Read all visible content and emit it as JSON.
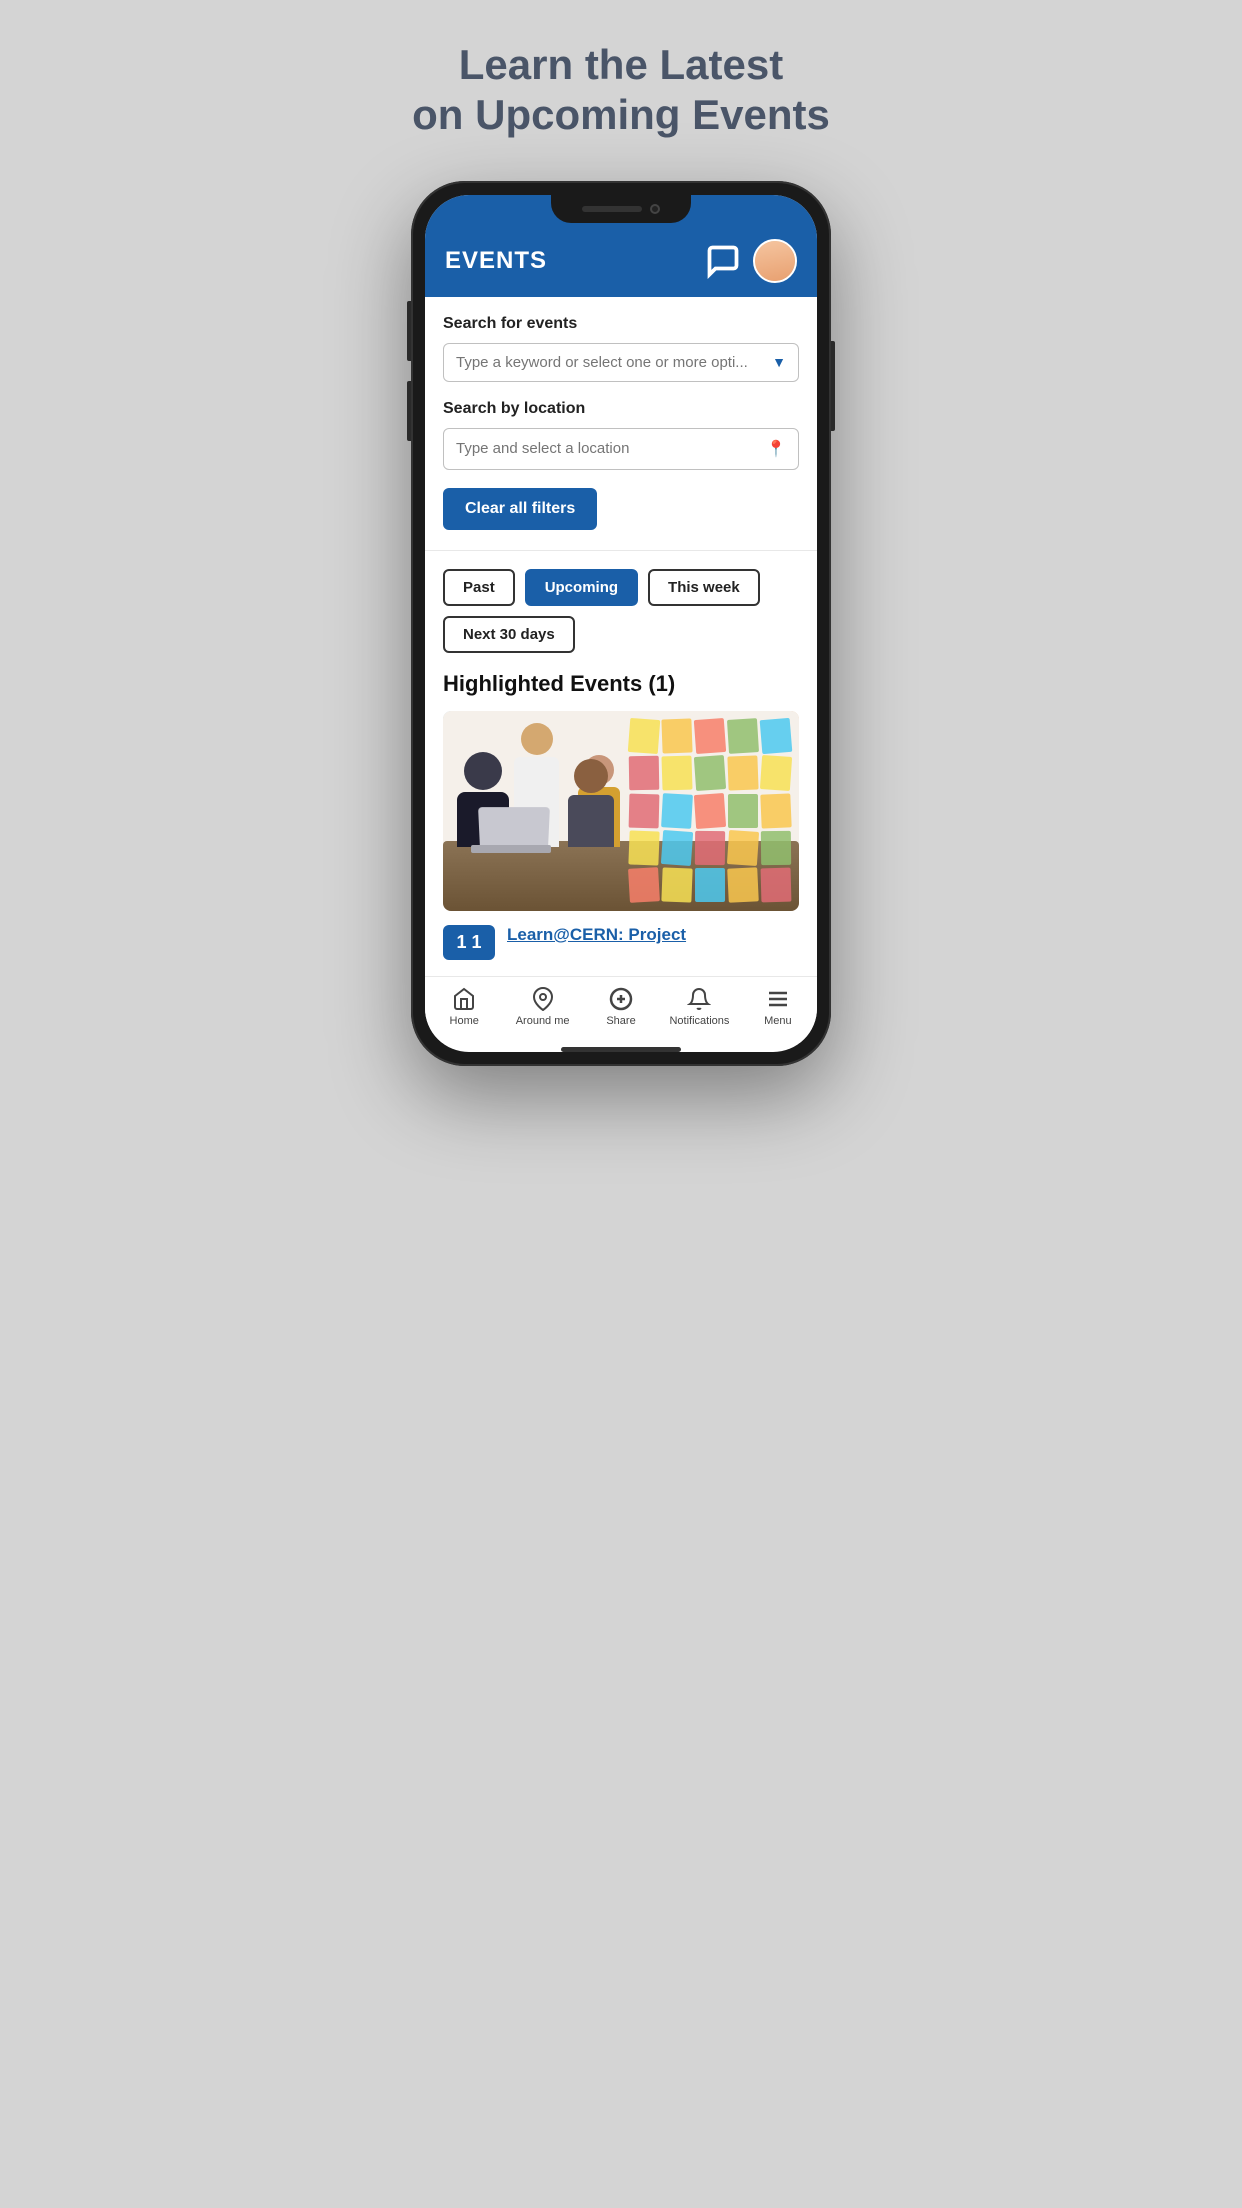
{
  "page": {
    "headline_line1": "Learn the Latest",
    "headline_line2": "on Upcoming Events"
  },
  "app": {
    "header": {
      "title": "EVENTS",
      "chat_icon_label": "chat",
      "avatar_label": "user avatar"
    },
    "search": {
      "keyword_label": "Search for events",
      "keyword_placeholder": "Type a keyword or select one or more opti...",
      "location_label": "Search by location",
      "location_placeholder": "Type and select a location"
    },
    "filters": {
      "clear_label": "Clear all filters",
      "tabs": [
        {
          "id": "past",
          "label": "Past",
          "active": false
        },
        {
          "id": "upcoming",
          "label": "Upcoming",
          "active": true
        },
        {
          "id": "this_week",
          "label": "This week",
          "active": false
        },
        {
          "id": "next_30",
          "label": "Next 30 days",
          "active": false
        }
      ]
    },
    "highlighted_title": "Highlighted Events (1)",
    "event": {
      "date_month": "",
      "date_day": "1 1",
      "title": "Learn@CERN: Project"
    },
    "bottom_nav": [
      {
        "id": "home",
        "label": "Home",
        "icon": "🏠"
      },
      {
        "id": "around_me",
        "label": "Around me",
        "icon": "📍"
      },
      {
        "id": "share",
        "label": "Share",
        "icon": "➕"
      },
      {
        "id": "notifications",
        "label": "Notifications",
        "icon": "🔔"
      },
      {
        "id": "menu",
        "label": "Menu",
        "icon": "☰"
      }
    ]
  },
  "colors": {
    "primary_blue": "#1a5fa8",
    "dark_text": "#222222",
    "light_gray": "#d4d4d4",
    "border_gray": "#c0c0c0"
  },
  "sticky_colors": [
    "#f7e155",
    "#f9c74f",
    "#f77f6a",
    "#90be6d",
    "#4cc9f0",
    "#e06c75",
    "#f7e155",
    "#90be6d",
    "#f9c74f",
    "#f7e155",
    "#e06c75",
    "#4cc9f0",
    "#f77f6a",
    "#90be6d",
    "#f9c74f",
    "#f7e155",
    "#4cc9f0",
    "#e06c75",
    "#f9c74f",
    "#90be6d",
    "#f77f6a",
    "#f7e155",
    "#4cc9f0",
    "#f9c74f",
    "#e06c75"
  ]
}
